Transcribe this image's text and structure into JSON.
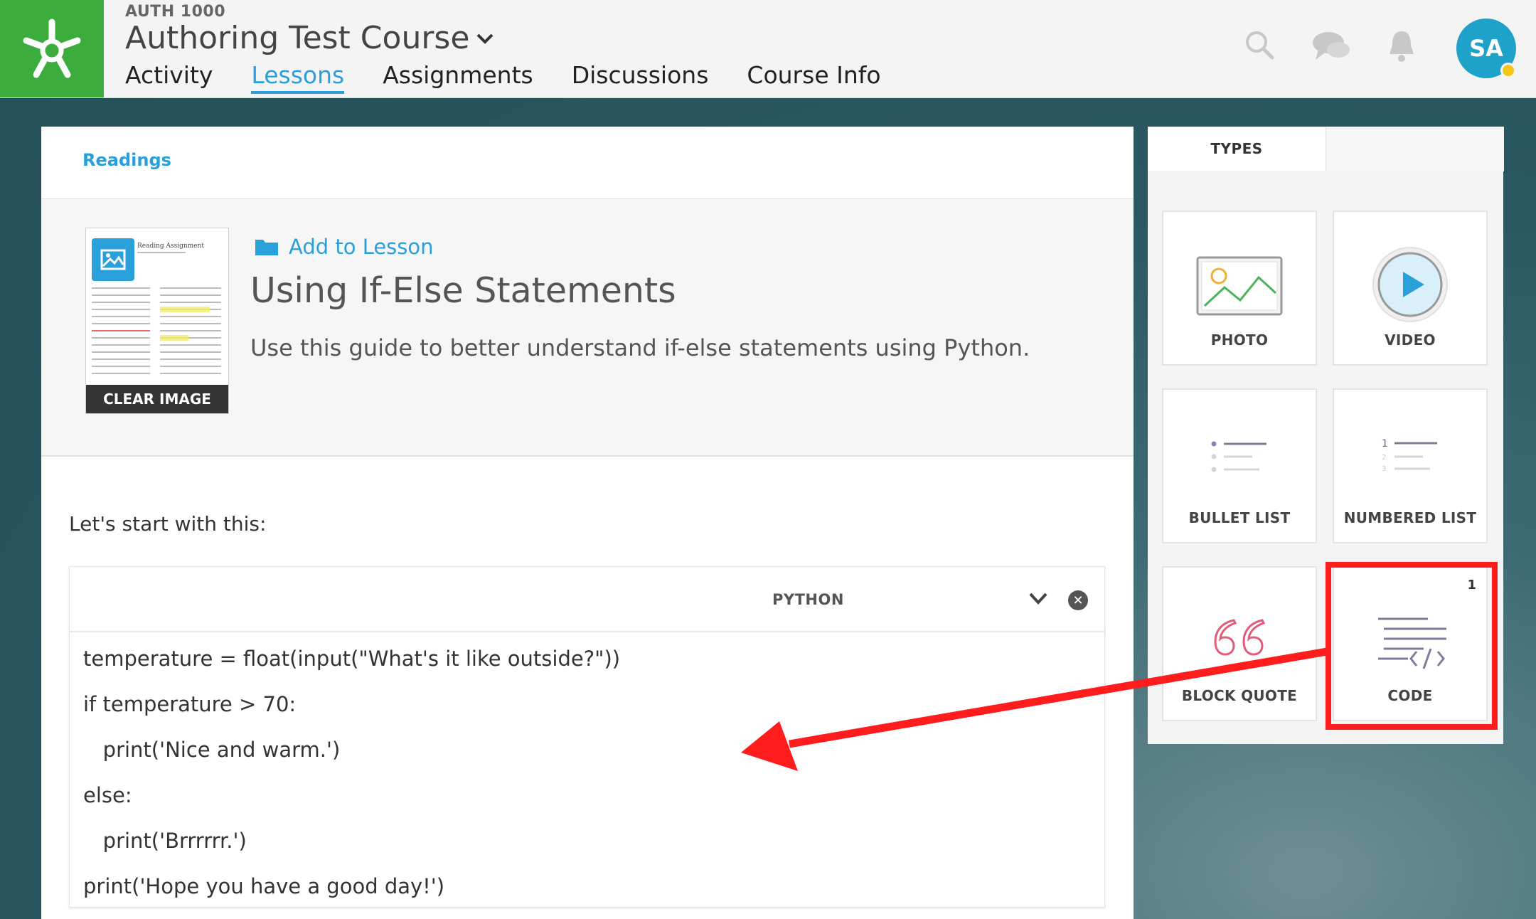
{
  "header": {
    "course_code": "AUTH 1000",
    "course_title": "Authoring Test Course",
    "nav": [
      {
        "label": "Activity",
        "active": false
      },
      {
        "label": "Lessons",
        "active": true
      },
      {
        "label": "Assignments",
        "active": false
      },
      {
        "label": "Discussions",
        "active": false
      },
      {
        "label": "Course Info",
        "active": false
      }
    ],
    "icons": [
      "search-icon",
      "chat-icon",
      "bell-icon"
    ],
    "avatar_initials": "SA"
  },
  "main": {
    "section_label": "Readings",
    "reading": {
      "thumbnail_title": "Reading Assignment",
      "clear_image_label": "CLEAR IMAGE",
      "add_to_lesson_label": "Add to Lesson",
      "title": "Using If-Else Statements",
      "description": "Use this guide to better understand if-else statements using Python."
    },
    "intro_text": "Let's start with this:",
    "code_block": {
      "language": "PYTHON",
      "lines": [
        "temperature = float(input(\"What's it like outside?\"))",
        "if temperature > 70:",
        "   print('Nice and warm.')",
        "else:",
        "   print('Brrrrrr.')",
        "print('Hope you have a good day!')"
      ]
    }
  },
  "types_panel": {
    "tab_label": "TYPES",
    "tiles": [
      {
        "label": "PHOTO",
        "icon": "photo-icon"
      },
      {
        "label": "VIDEO",
        "icon": "video-play-icon"
      },
      {
        "label": "BULLET LIST",
        "icon": "bullet-list-icon"
      },
      {
        "label": "NUMBERED LIST",
        "icon": "numbered-list-icon"
      },
      {
        "label": "BLOCK QUOTE",
        "icon": "quote-icon"
      },
      {
        "label": "CODE",
        "icon": "code-icon",
        "badge": "1"
      }
    ]
  },
  "colors": {
    "brand_green": "#3cac3c",
    "accent_blue": "#2aa0db",
    "annotation_red": "#ff1c1c",
    "avatar_teal": "#1fa2c9"
  }
}
